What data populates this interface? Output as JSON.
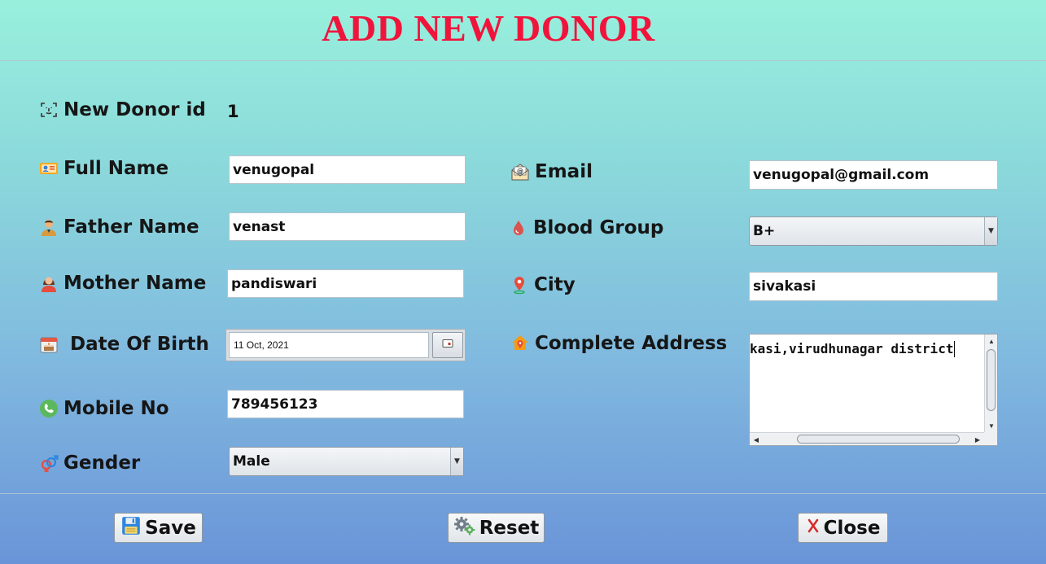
{
  "header": {
    "title": "ADD NEW DONOR"
  },
  "form": {
    "donor_id": {
      "label": "New Donor id",
      "value": "1"
    },
    "full_name": {
      "label": "Full Name",
      "value": "venugopal"
    },
    "father_name": {
      "label": "Father Name",
      "value": "venast"
    },
    "mother_name": {
      "label": "Mother Name",
      "value": "pandiswari"
    },
    "dob": {
      "label": "Date Of Birth",
      "value": "11 Oct, 2021"
    },
    "mobile": {
      "label": "Mobile No",
      "value": "789456123"
    },
    "gender": {
      "label": "Gender",
      "value": "Male"
    },
    "email": {
      "label": "Email",
      "value": "venugopal@gmail.com"
    },
    "blood_group": {
      "label": "Blood Group",
      "value": "B+"
    },
    "city": {
      "label": "City",
      "value": "sivakasi"
    },
    "address": {
      "label": "Complete Address",
      "value": "kasi,virudhunagar district"
    }
  },
  "footer": {
    "save_label": "Save",
    "reset_label": "Reset",
    "close_label": "Close"
  },
  "colors": {
    "title": "#f0143c",
    "background_top": "#98f0dc",
    "background_bottom": "#6a94d8"
  },
  "icons": {
    "donor_id": "face-id-icon",
    "full_name": "id-card-icon",
    "father_name": "man-icon",
    "mother_name": "woman-icon",
    "dob": "birthday-cake-calendar-icon",
    "mobile": "phone-icon",
    "gender": "gender-icon",
    "email": "email-icon",
    "blood_group": "blood-drop-icon",
    "city": "location-pin-icon",
    "address": "home-location-icon",
    "save": "floppy-disk-icon",
    "reset": "gears-icon",
    "close": "close-x-icon"
  }
}
